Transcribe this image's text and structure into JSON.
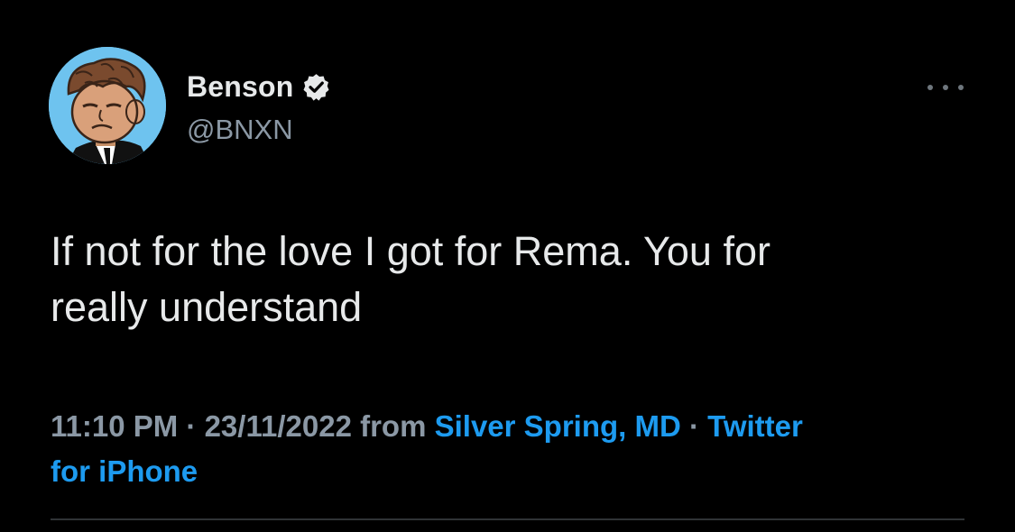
{
  "user": {
    "display_name": "Benson",
    "handle": "@BNXN",
    "verified_icon": "verified-badge-icon",
    "avatar_icon": "cartoon-avatar"
  },
  "tweet": {
    "text_line1": "If not for the love I got for Rema. You for",
    "text_line2": "really understand"
  },
  "meta": {
    "time": "11:10 PM",
    "separator1": " · ",
    "date": "23/11/2022",
    "from_word": " from ",
    "location": "Silver Spring, MD",
    "separator2": " · ",
    "source_part1": "Twitter",
    "source_part2": "for iPhone"
  },
  "colors": {
    "background": "#000000",
    "text_primary": "#e7e9ea",
    "text_secondary": "#8b98a5",
    "link": "#1d9bf0",
    "avatar_bg": "#6ec3ef"
  },
  "more_icon": "more-horizontal-icon"
}
